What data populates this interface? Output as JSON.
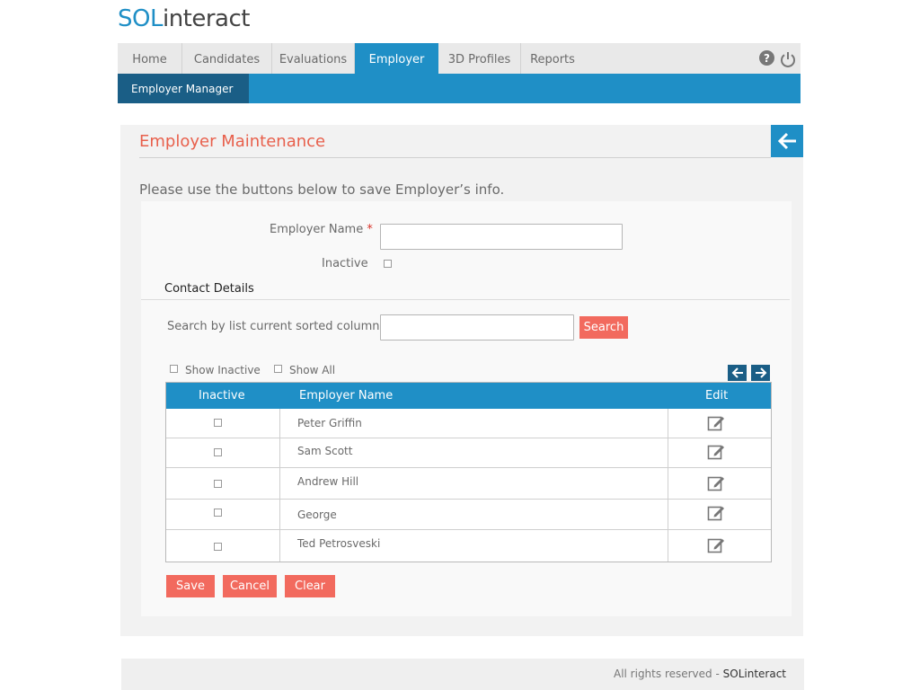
{
  "logo": {
    "prefix": "SOL",
    "rest": "interact"
  },
  "nav": {
    "tabs": [
      {
        "label": "Home"
      },
      {
        "label": "Candidates"
      },
      {
        "label": "Evaluations"
      },
      {
        "label": "Employer"
      },
      {
        "label": "3D Profiles"
      },
      {
        "label": "Reports"
      }
    ],
    "active_tab": "Employer",
    "help_label": "?",
    "subtabs": [
      {
        "label": "Employer Manager"
      }
    ]
  },
  "page": {
    "title": "Employer Maintenance",
    "intro": "Please use the buttons below to save Employer’s info."
  },
  "form": {
    "employer_name_label": "Employer Name",
    "required_marker": "*",
    "employer_name_value": "",
    "inactive_label": "Inactive",
    "inactive_checked": false
  },
  "contact": {
    "heading": "Contact Details",
    "search_label": "Search by list current sorted column:",
    "search_value": "",
    "search_button": "Search",
    "show_inactive_label": "Show Inactive",
    "show_all_label": "Show All"
  },
  "grid": {
    "columns": [
      "Inactive",
      "Employer Name",
      "Edit"
    ],
    "rows": [
      {
        "inactive": false,
        "name": "Peter Griffin"
      },
      {
        "inactive": false,
        "name": "Sam Scott"
      },
      {
        "inactive": false,
        "name": "Andrew Hill"
      },
      {
        "inactive": false,
        "name": "George"
      },
      {
        "inactive": false,
        "name": "Ted Petrosveski"
      }
    ]
  },
  "actions": {
    "save": "Save",
    "cancel": "Cancel",
    "clear": "Clear"
  },
  "footer": {
    "text": "All rights reserved - ",
    "brand": "SOLinteract"
  },
  "colors": {
    "accent": "#1f8fc6",
    "dark_accent": "#1a5e86",
    "button": "#f26a5e",
    "title": "#e8604c"
  }
}
